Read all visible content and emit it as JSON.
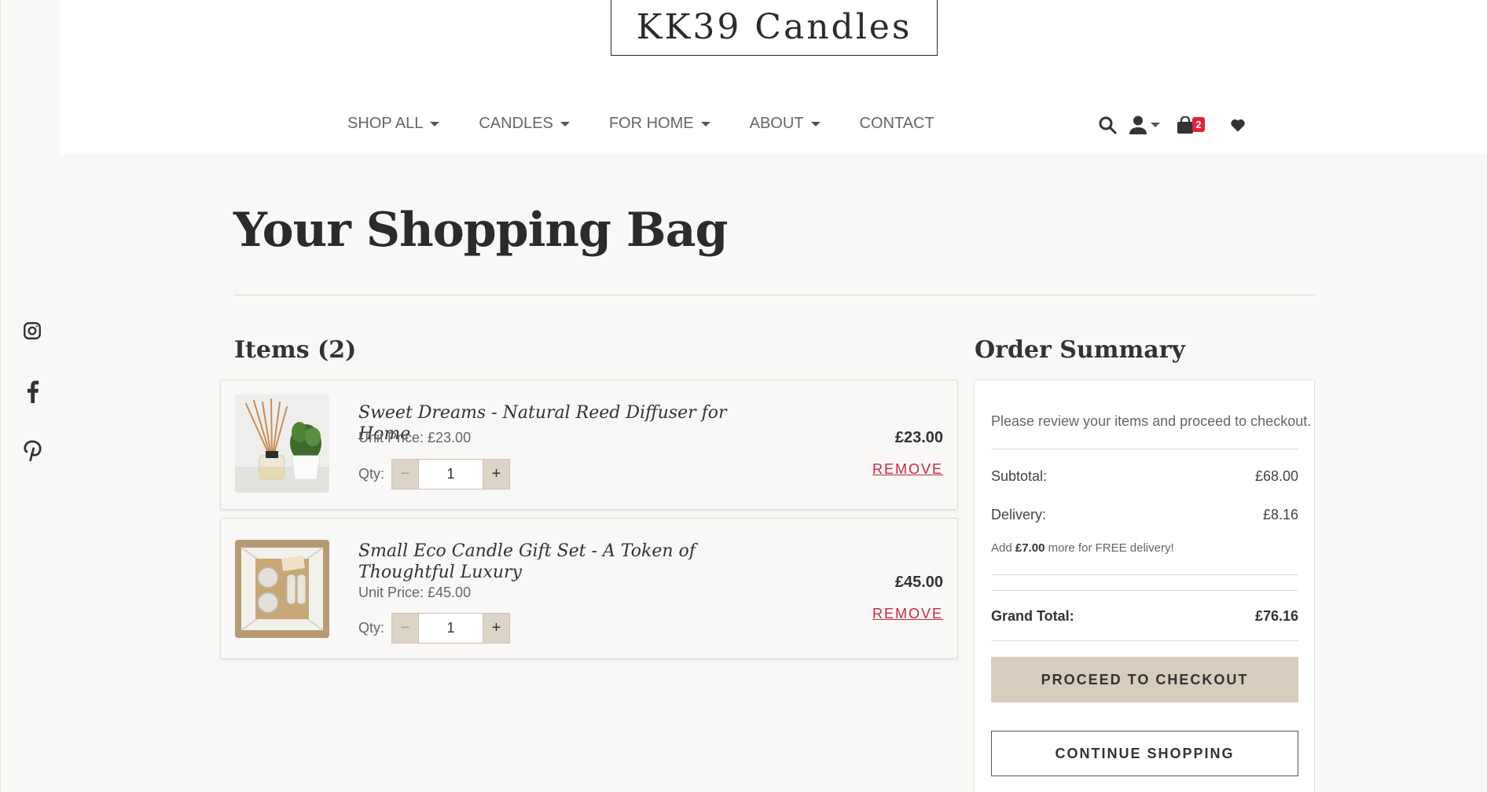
{
  "brand": {
    "logo": "KK39 Candles"
  },
  "nav": {
    "items": [
      {
        "label": "SHOP ALL",
        "has_dropdown": true
      },
      {
        "label": "CANDLES",
        "has_dropdown": true
      },
      {
        "label": "FOR HOME",
        "has_dropdown": true
      },
      {
        "label": "ABOUT",
        "has_dropdown": true
      },
      {
        "label": "CONTACT",
        "has_dropdown": false
      }
    ],
    "icons": [
      "search-icon",
      "user-icon",
      "shopping-bag-icon",
      "heart-icon"
    ],
    "bag_count": "2"
  },
  "social": [
    "instagram-icon",
    "facebook-icon",
    "pinterest-icon"
  ],
  "page": {
    "title": "Your Shopping Bag"
  },
  "items_section": {
    "title": "Items (2)",
    "qty_label": "Qty:",
    "minus": "−",
    "plus": "+",
    "items": [
      {
        "name": "Sweet Dreams - Natural Reed Diffuser for Home",
        "unit_price": "Unit Price: £23.00",
        "qty": "1",
        "total": "£23.00",
        "remove": "REMOVE"
      },
      {
        "name": "Small Eco Candle Gift Set - A Token of Thoughtful Luxury",
        "unit_price": "Unit Price: £45.00",
        "qty": "1",
        "total": "£45.00",
        "remove": "REMOVE"
      }
    ]
  },
  "summary": {
    "title": "Order Summary",
    "note": "Please review your items and proceed to checkout.",
    "subtotal_label": "Subtotal:",
    "subtotal_value": "£68.00",
    "delivery_label": "Delivery:",
    "delivery_value": "£8.16",
    "free_prefix": "Add",
    "free_amount": "£7.00",
    "free_suffix": "more for FREE delivery!",
    "grand_total_label": "Grand Total:",
    "grand_total_value": "£76.16",
    "checkout_label": "PROCEED TO CHECKOUT",
    "continue_label": "CONTINUE SHOPPING"
  },
  "colors": {
    "accent_beige": "#d8ccbd",
    "remove_red": "#c8283c",
    "badge_red": "#e3213b",
    "page_bg": "#f9f8f6"
  }
}
